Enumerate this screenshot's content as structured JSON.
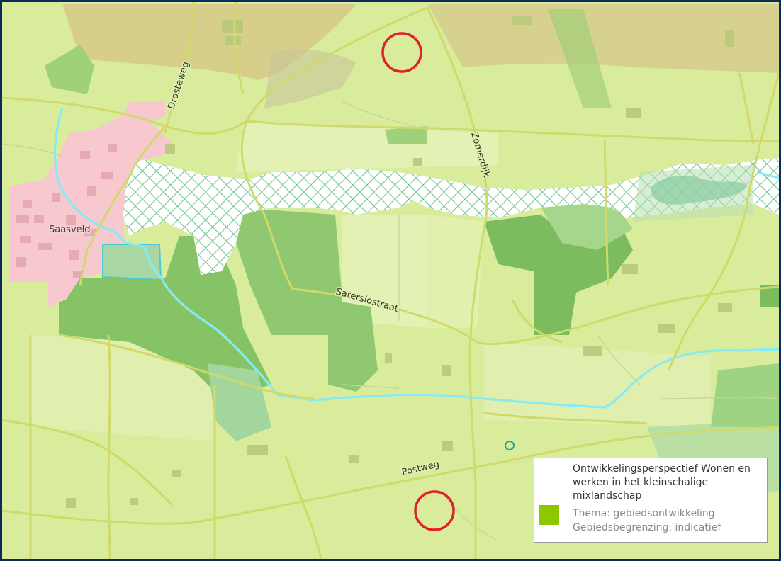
{
  "map": {
    "place_label": "Saasveld",
    "road_labels": {
      "drosteweg": "Drosteweg",
      "zomerdijk": "Zomerdijk",
      "saterslostraat": "Saterslostraat",
      "postweg": "Postweg"
    },
    "markers": [
      {
        "name": "marker-north",
        "shape": "red circle"
      },
      {
        "name": "marker-south",
        "shape": "red circle"
      }
    ],
    "colors": {
      "base_land": "#d9ec9c",
      "field_light": "#e3f1b3",
      "forest": "#8fc870",
      "forest_dark": "#77b85e",
      "built_area": "#f7c9cf",
      "water": "#7fe8f0",
      "hatch": "#6cc28a",
      "marker": "#e0202a",
      "legend_swatch": "#8cc800"
    }
  },
  "legend": {
    "title": "Ontwikkelingsperspectief Wonen en werken in het kleinschalige mixlandschap",
    "theme": "Thema: gebiedsontwikkeling",
    "boundary": "Gebiedsbegrenzing: indicatief",
    "swatch_color": "#8cc800"
  }
}
